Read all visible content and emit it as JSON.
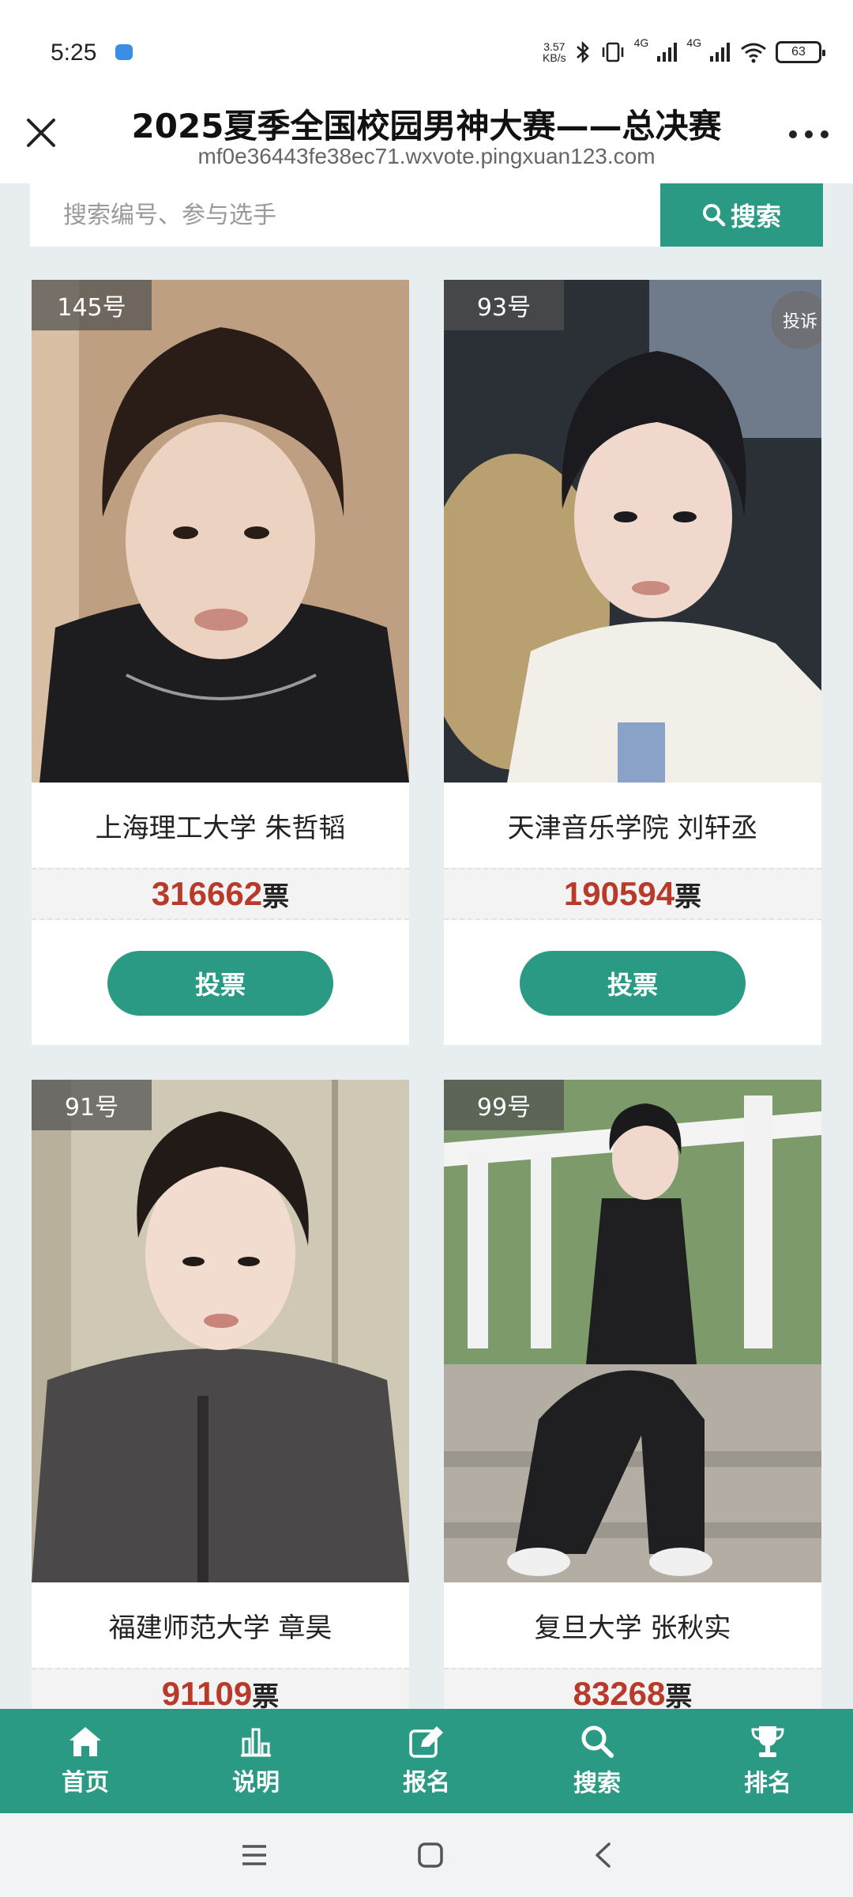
{
  "status_bar": {
    "time": "5:25",
    "net_speed_value": "3.57",
    "net_speed_unit": "KB/s",
    "network_label_1": "4G",
    "network_label_2": "4G",
    "battery": "63"
  },
  "header": {
    "title": "2025夏季全国校园男神大赛——总决赛",
    "url": "mf0e36443fe38ec71.wxvote.pingxuan123.com"
  },
  "search": {
    "placeholder": "搜索编号、参与选手",
    "button_label": "搜索"
  },
  "cards": [
    {
      "number": "145号",
      "name": "上海理工大学 朱哲韬",
      "votes": "316662",
      "unit": "票",
      "vote_label": "投票",
      "report": ""
    },
    {
      "number": "93号",
      "name": "天津音乐学院 刘轩丞",
      "votes": "190594",
      "unit": "票",
      "vote_label": "投票",
      "report": "投诉"
    },
    {
      "number": "91号",
      "name": "福建师范大学 章昊",
      "votes": "91109",
      "unit": "票",
      "vote_label": "",
      "report": ""
    },
    {
      "number": "99号",
      "name": "复旦大学 张秋实",
      "votes": "83268",
      "unit": "票",
      "vote_label": "",
      "report": ""
    }
  ],
  "bottom_nav": [
    {
      "label": "首页",
      "icon": "home-icon"
    },
    {
      "label": "说明",
      "icon": "chart-icon"
    },
    {
      "label": "报名",
      "icon": "edit-icon"
    },
    {
      "label": "搜索",
      "icon": "search-icon"
    },
    {
      "label": "排名",
      "icon": "trophy-icon"
    }
  ],
  "colors": {
    "accent": "#2a9a84",
    "votes": "#b83a2a"
  }
}
